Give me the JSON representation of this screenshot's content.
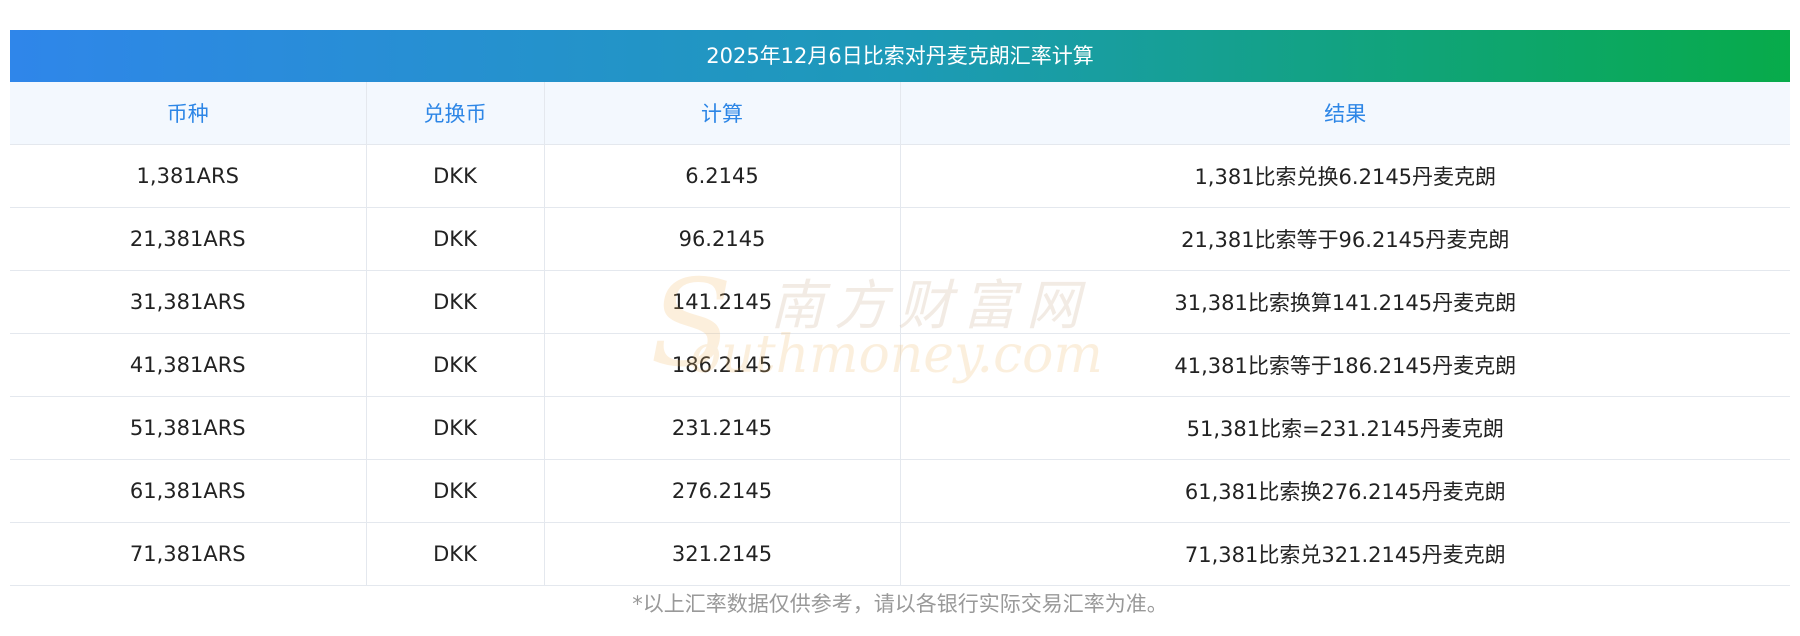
{
  "title": "2025年12月6日比索对丹麦克朗汇率计算",
  "headers": [
    "币种",
    "兑换币",
    "计算",
    "结果"
  ],
  "rows": [
    [
      "1,381ARS",
      "DKK",
      "6.2145",
      "1,381比索兑换6.2145丹麦克朗"
    ],
    [
      "21,381ARS",
      "DKK",
      "96.2145",
      "21,381比索等于96.2145丹麦克朗"
    ],
    [
      "31,381ARS",
      "DKK",
      "141.2145",
      "31,381比索换算141.2145丹麦克朗"
    ],
    [
      "41,381ARS",
      "DKK",
      "186.2145",
      "41,381比索等于186.2145丹麦克朗"
    ],
    [
      "51,381ARS",
      "DKK",
      "231.2145",
      "51,381比索=231.2145丹麦克朗"
    ],
    [
      "61,381ARS",
      "DKK",
      "276.2145",
      "61,381比索换276.2145丹麦克朗"
    ],
    [
      "71,381ARS",
      "DKK",
      "321.2145",
      "71,381比索兑321.2145丹麦克朗"
    ]
  ],
  "watermark": {
    "cn": "南方财富网",
    "en_initial": "S",
    "en": "outhmoney.com"
  },
  "footer": "*以上汇率数据仅供参考，请以各银行实际交易汇率为准。",
  "colors": {
    "header_text": "#2d86e6",
    "title_gradient_start": "#2f86ea",
    "title_gradient_end": "#07ab4a",
    "header_bg": "#f3f8fe"
  }
}
